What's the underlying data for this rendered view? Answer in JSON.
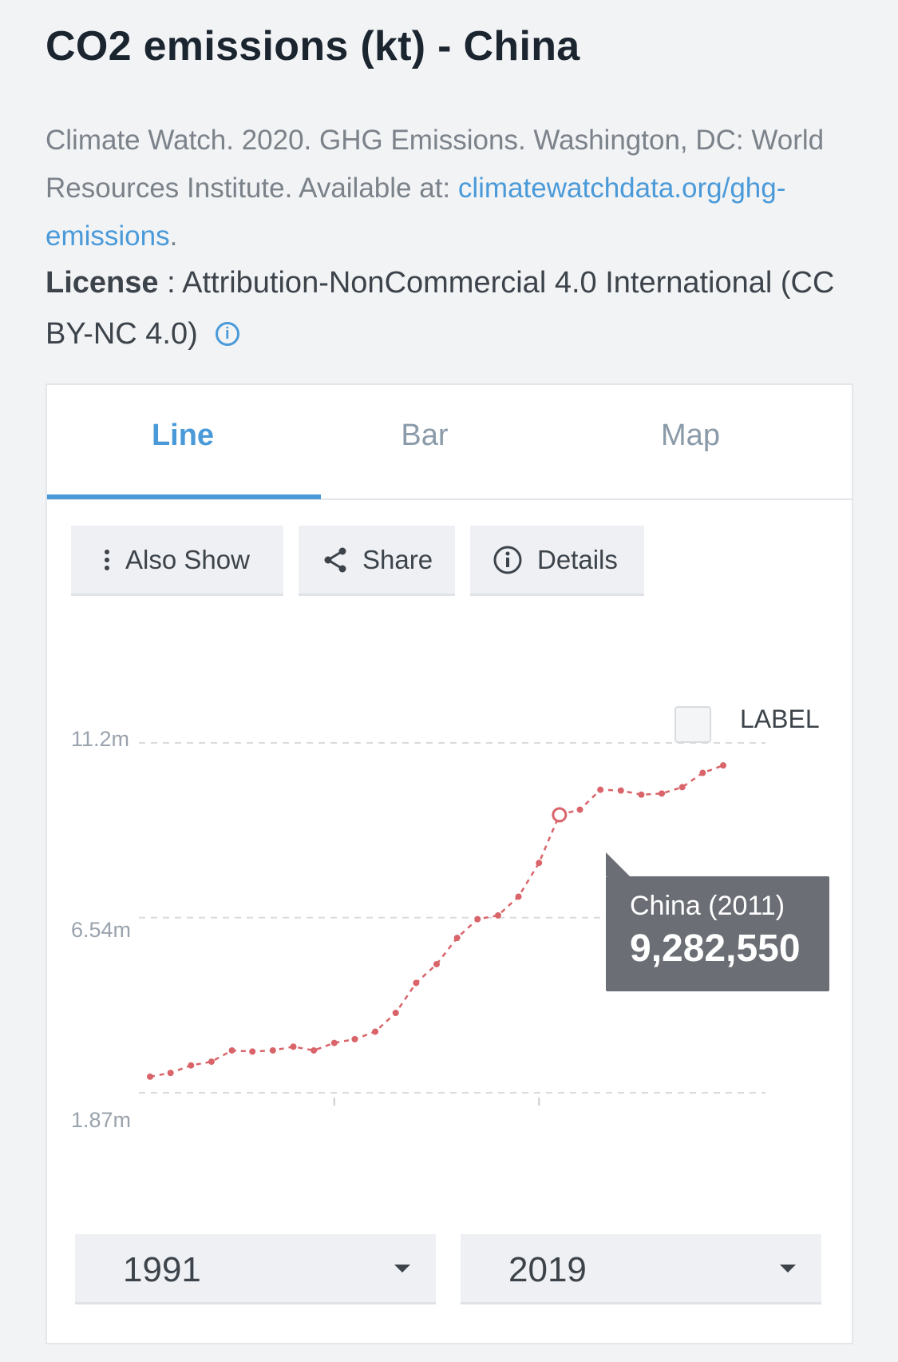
{
  "header": {
    "title": "CO2 emissions (kt) - China",
    "source_prefix": "Climate Watch. 2020. GHG Emissions. Washington, DC: World Resources Institute. Available at: ",
    "source_link": "climatewatchdata.org/ghg-emissions",
    "source_suffix": ".",
    "license_label": "License",
    "license_text": " : Attribution-NonCommercial 4.0 International (CC BY-NC 4.0)"
  },
  "tabs": [
    {
      "label": "Line",
      "active": true
    },
    {
      "label": "Bar",
      "active": false
    },
    {
      "label": "Map",
      "active": false
    }
  ],
  "toolbar": {
    "also_show": "Also Show",
    "share": "Share",
    "details": "Details"
  },
  "legend": {
    "label": "LABEL"
  },
  "tooltip": {
    "line1": "China (2011)",
    "line2": "9,282,550"
  },
  "range": {
    "from": "1991",
    "to": "2019"
  },
  "colors": {
    "accent": "#4a9ad9",
    "series": "#d9646a",
    "tooltip_bg": "#6b6f75"
  },
  "chart_data": {
    "type": "line",
    "y_tick_labels": [
      "11.2m",
      "6.54m",
      "1.87m"
    ],
    "y_ticks": [
      11200000,
      6540000,
      1870000
    ],
    "ylim": [
      1870000,
      11200000
    ],
    "x": [
      1991,
      1992,
      1993,
      1994,
      1995,
      1996,
      1997,
      1998,
      1999,
      2000,
      2001,
      2002,
      2003,
      2004,
      2005,
      2006,
      2007,
      2008,
      2009,
      2010,
      2011,
      2012,
      2013,
      2014,
      2015,
      2016,
      2017,
      2018,
      2019
    ],
    "series": [
      {
        "name": "China",
        "values": [
          2300000,
          2400000,
          2600000,
          2700000,
          3000000,
          2970000,
          3000000,
          3100000,
          3000000,
          3200000,
          3300000,
          3500000,
          4000000,
          4800000,
          5300000,
          6000000,
          6500000,
          6600000,
          7100000,
          8000000,
          9282550,
          9420000,
          9950000,
          9930000,
          9820000,
          9850000,
          10020000,
          10400000,
          10600000
        ]
      }
    ],
    "highlight": {
      "x": 2011,
      "value": 9282550
    },
    "grid": true
  }
}
